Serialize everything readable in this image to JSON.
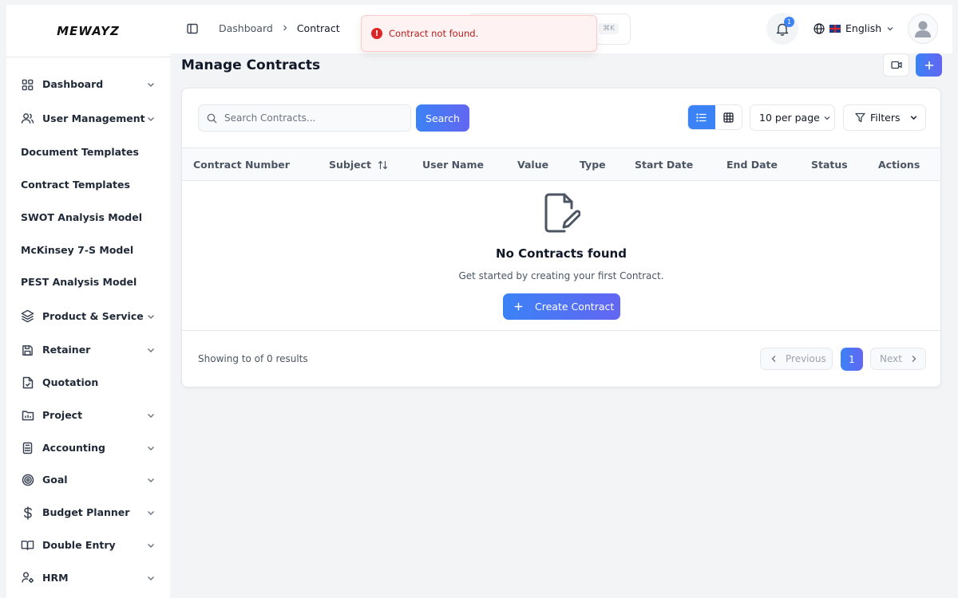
{
  "brand": {
    "logo_text": "MEWAYZ"
  },
  "sidebar": {
    "items": [
      {
        "label": "Dashboard",
        "icon": "grid-icon",
        "has_chevron": true
      },
      {
        "label": "User Management",
        "icon": "users-icon",
        "has_chevron": true
      },
      {
        "label": "Document Templates",
        "icon": "",
        "has_chevron": false
      },
      {
        "label": "Contract Templates",
        "icon": "",
        "has_chevron": false
      },
      {
        "label": "SWOT Analysis Model",
        "icon": "",
        "has_chevron": false
      },
      {
        "label": "McKinsey 7-S Model",
        "icon": "",
        "has_chevron": false
      },
      {
        "label": "PEST Analysis Model",
        "icon": "",
        "has_chevron": false
      },
      {
        "label": "Product & Service",
        "icon": "layers-icon",
        "has_chevron": true
      },
      {
        "label": "Retainer",
        "icon": "save-icon",
        "has_chevron": true
      },
      {
        "label": "Quotation",
        "icon": "file-check-icon",
        "has_chevron": false
      },
      {
        "label": "Project",
        "icon": "folder-icon",
        "has_chevron": true
      },
      {
        "label": "Accounting",
        "icon": "calculator-icon",
        "has_chevron": true
      },
      {
        "label": "Goal",
        "icon": "target-icon",
        "has_chevron": true
      },
      {
        "label": "Budget Planner",
        "icon": "dollar-icon",
        "has_chevron": true
      },
      {
        "label": "Double Entry",
        "icon": "book-icon",
        "has_chevron": true
      },
      {
        "label": "HRM",
        "icon": "user-cog-icon",
        "has_chevron": true
      }
    ]
  },
  "topbar": {
    "breadcrumb": [
      "Dashboard",
      "Contract"
    ],
    "search_shortcut": "⌘K",
    "notification_count": "1",
    "language": "English"
  },
  "toast": {
    "message": "Contract not found."
  },
  "page": {
    "title": "Manage Contracts"
  },
  "toolbar": {
    "search_placeholder": "Search Contracts...",
    "search_button": "Search",
    "per_page": "10 per page",
    "filters": "Filters"
  },
  "table": {
    "columns": [
      "Contract Number",
      "Subject",
      "User Name",
      "Value",
      "Type",
      "Start Date",
      "End Date",
      "Status",
      "Actions"
    ],
    "rows": []
  },
  "empty_state": {
    "title": "No Contracts found",
    "subtitle": "Get started by creating your first Contract.",
    "button": "Create Contract"
  },
  "pagination": {
    "summary": "Showing to of 0 results",
    "previous": "Previous",
    "current_page": "1",
    "next": "Next"
  },
  "colors": {
    "accent": "#3b82f6",
    "accent_end": "#6366f1",
    "error": "#dc2626"
  }
}
